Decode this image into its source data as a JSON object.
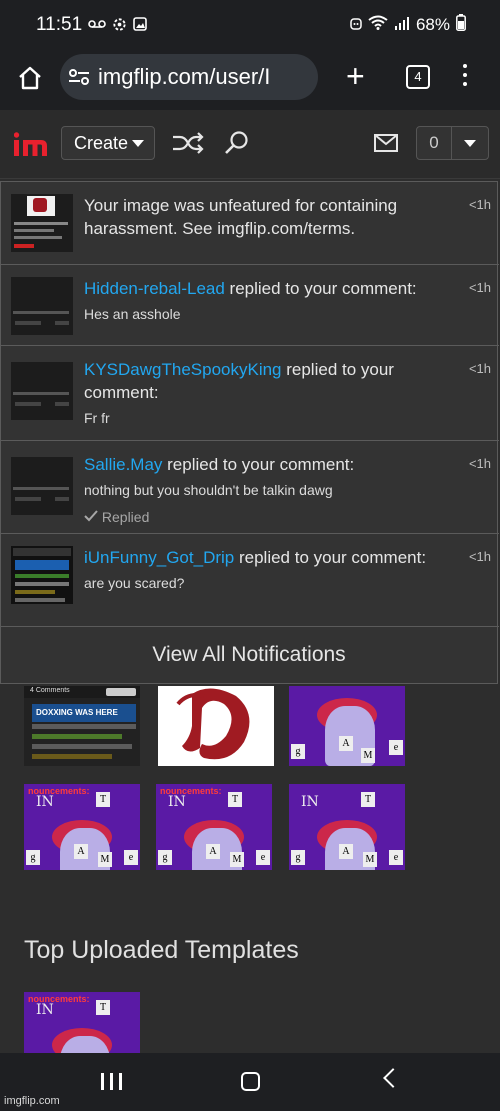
{
  "status_bar": {
    "time": "11:51",
    "battery": "68%"
  },
  "browser": {
    "url": "imgflip.com/user/I",
    "tab_count": "4"
  },
  "header": {
    "create_label": "Create",
    "notification_count": "0"
  },
  "notifications": [
    {
      "user": "",
      "message": "Your image was unfeatured for containing harassment. See imgflip.com/terms.",
      "snippet": "",
      "time": "<1h",
      "replied": ""
    },
    {
      "user": "Hidden-rebal-Lead",
      "message": " replied to your comment:",
      "snippet": "Hes an asshole",
      "time": "<1h",
      "replied": ""
    },
    {
      "user": "KYSDawgTheSpookyKing",
      "message": " replied to your comment:",
      "snippet": "Fr fr",
      "time": "<1h",
      "replied": ""
    },
    {
      "user": "Sallie.May",
      "message": " replied to your comment:",
      "snippet": "nothing but you shouldn't be talkin dawg",
      "time": "<1h",
      "replied": "Replied"
    },
    {
      "user": "iUnFunny_Got_Drip",
      "message": " replied to your comment:",
      "snippet": "are you scared?",
      "time": "<1h",
      "replied": ""
    }
  ],
  "view_all_label": "View All Notifications",
  "grid": {
    "doxx_caption": "DOXXING WAS HERE",
    "comments_label": "4 Comments",
    "meme_top_text": "nouncements:",
    "meme_in": "IN",
    "cards": [
      "T",
      "g",
      "A",
      "M",
      "e"
    ]
  },
  "section_title": "Top Uploaded Templates",
  "watermark": "imgflip.com"
}
